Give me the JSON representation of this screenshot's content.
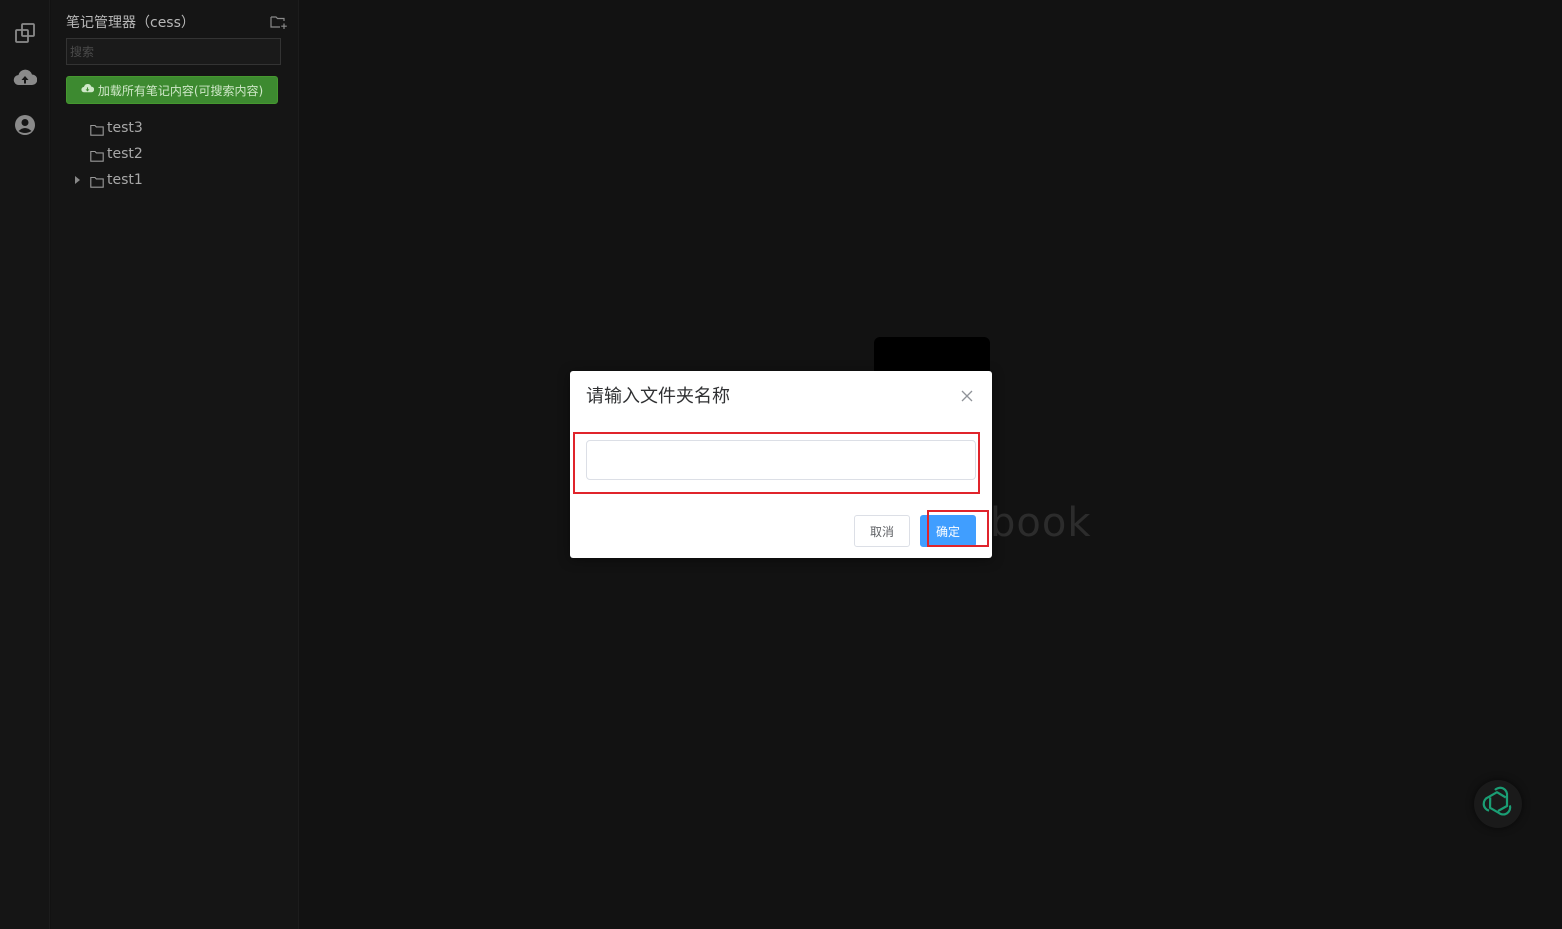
{
  "activity_bar": {
    "items": [
      {
        "icon": "copy-documents-icon"
      },
      {
        "icon": "cloud-upload-icon"
      },
      {
        "icon": "user-account-icon"
      }
    ]
  },
  "sidebar": {
    "title": "笔记管理器（cess）",
    "search_placeholder": "搜索",
    "load_button_label": "加载所有笔记内容(可搜索内容)",
    "tree": [
      {
        "label": "test3",
        "expandable": false
      },
      {
        "label": "test2",
        "expandable": false
      },
      {
        "label": "test1",
        "expandable": true
      }
    ]
  },
  "main": {
    "brand_text": "book"
  },
  "dialog": {
    "title": "请输入文件夹名称",
    "input_value": "",
    "cancel_label": "取消",
    "ok_label": "确定"
  },
  "colors": {
    "accent_green": "#3d8a30",
    "primary_blue": "#409eff",
    "highlight_red": "#e0242b",
    "assistant_green": "#1a9e74"
  }
}
